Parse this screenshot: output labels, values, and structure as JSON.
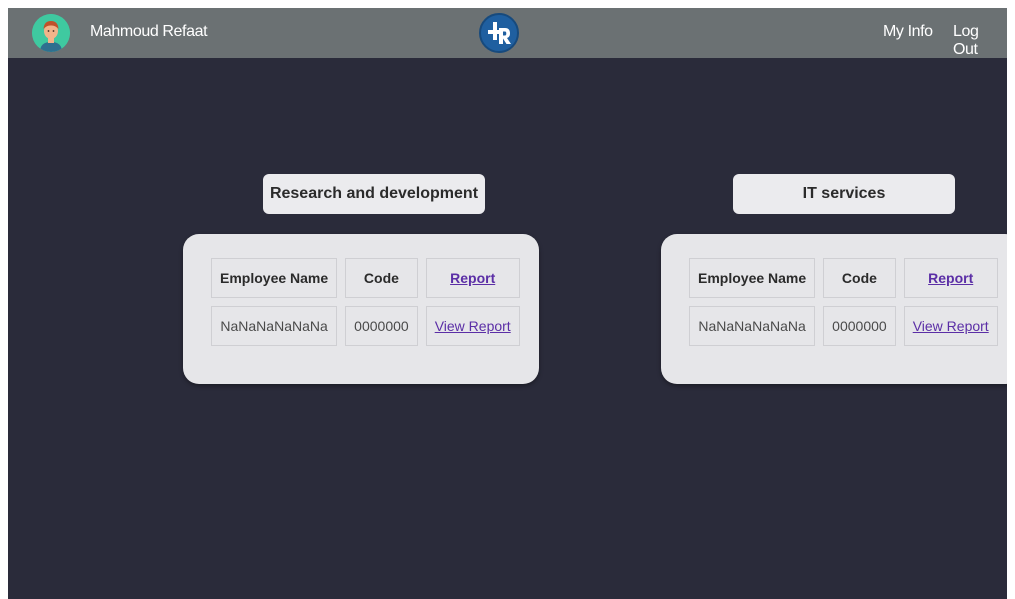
{
  "header": {
    "user_name": "Mahmoud Refaat",
    "logo_text": "HR",
    "nav": {
      "my_info": "My Info",
      "log_out": "Log Out"
    }
  },
  "departments": [
    {
      "title": "Research and development",
      "columns": {
        "name": "Employee Name",
        "code": "Code",
        "report": "Report"
      },
      "rows": [
        {
          "name": "NaNaNaNaNaNa",
          "code": "0000000",
          "report_link": "View Report"
        }
      ]
    },
    {
      "title": "IT services",
      "columns": {
        "name": "Employee Name",
        "code": "Code",
        "report": "Report"
      },
      "rows": [
        {
          "name": "NaNaNaNaNaNa",
          "code": "0000000",
          "report_link": "View Report"
        }
      ]
    }
  ],
  "colors": {
    "background": "#2a2b3a",
    "topbar": "#6b7173",
    "card": "#e6e6e9",
    "link": "#5b2ea6",
    "logo": "#1f5fa0"
  }
}
